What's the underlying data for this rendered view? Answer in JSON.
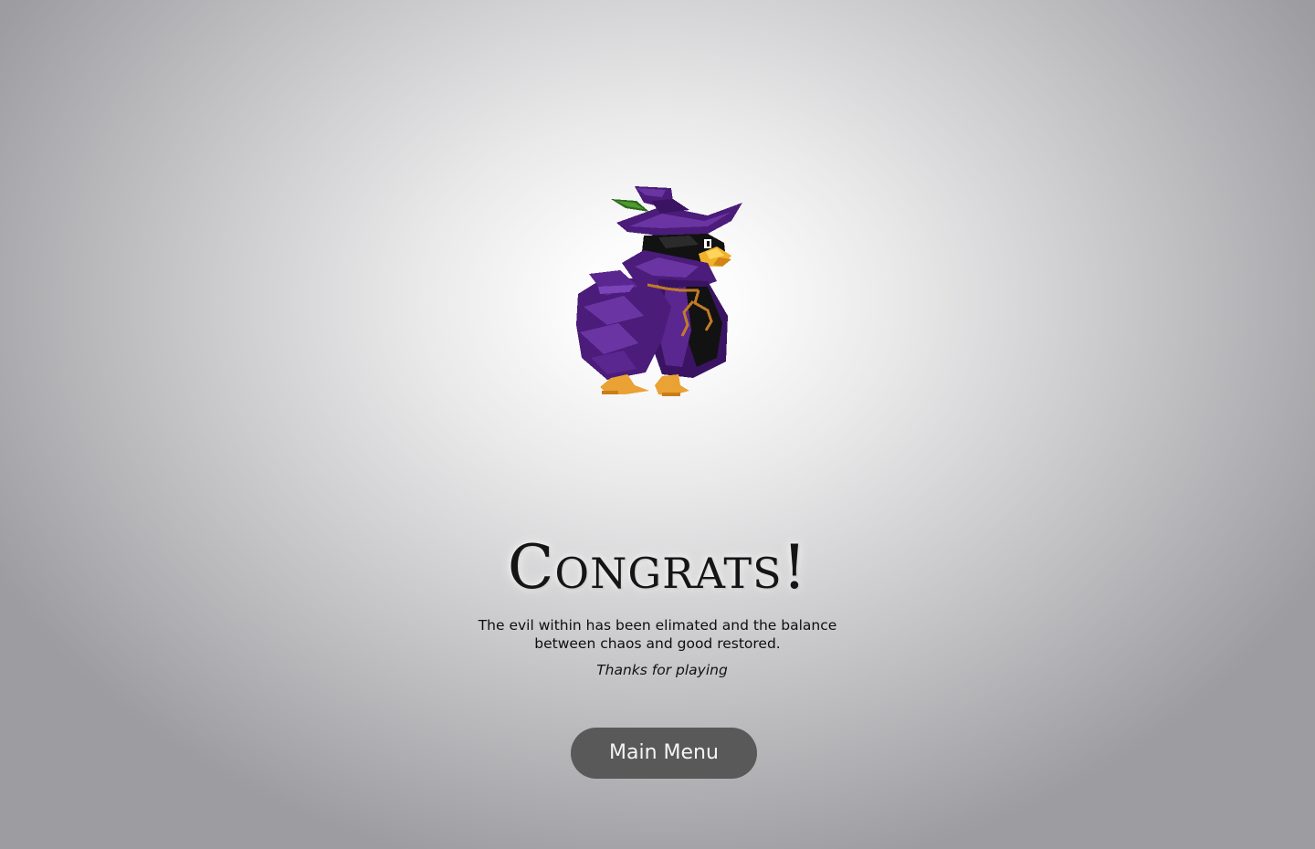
{
  "end_screen": {
    "title": "Congrats!",
    "message": "The evil within has been elimated and the balance between chaos and good restored.",
    "thanks": "Thanks for playing",
    "main_menu_label": "Main Menu"
  },
  "character": {
    "icon": "wizard-crow-icon",
    "colors": {
      "robe": "#4b1c7a",
      "robe_light": "#6a34a3",
      "robe_dark": "#2e0f4f",
      "beak": "#f0b22a",
      "feet": "#e9a233",
      "feather": "#2e6b1f",
      "body": "#121212"
    }
  }
}
